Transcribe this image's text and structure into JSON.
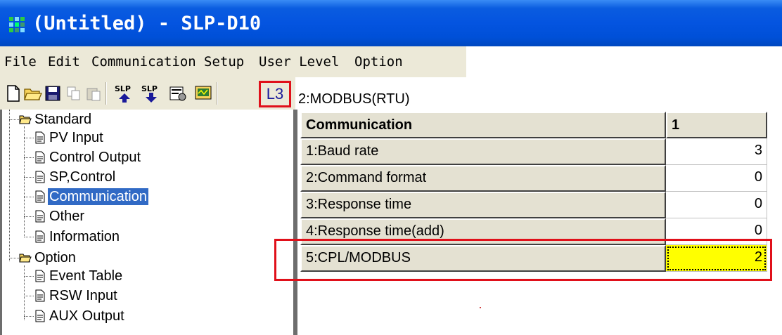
{
  "window": {
    "title": "(Untitled) - SLP-D10"
  },
  "menu": [
    {
      "label": "File"
    },
    {
      "label": "Edit"
    },
    {
      "label": "Communication"
    },
    {
      "label": "Setup"
    },
    {
      "label": "User Level"
    },
    {
      "label": "Option"
    }
  ],
  "toolbar": {
    "buttons": [
      {
        "icon": "new-file-icon"
      },
      {
        "icon": "open-folder-icon"
      },
      {
        "icon": "save-disk-icon"
      },
      {
        "icon": "copy-icon"
      },
      {
        "icon": "paste-icon"
      },
      {
        "icon": "slp-upload-icon"
      },
      {
        "icon": "slp-download-icon"
      },
      {
        "icon": "properties-icon"
      },
      {
        "icon": "monitor-icon"
      }
    ],
    "level_label": "L3"
  },
  "mode": {
    "text": "2:MODBUS(RTU)"
  },
  "tree": {
    "standard_label": "Standard",
    "standard_items": [
      {
        "label": "PV Input"
      },
      {
        "label": "Control Output"
      },
      {
        "label": "SP,Control"
      },
      {
        "label": "Communication",
        "selected": true
      },
      {
        "label": "Other"
      },
      {
        "label": "Information"
      }
    ],
    "option_label": "Option",
    "option_items": [
      {
        "label": "Event Table"
      },
      {
        "label": "RSW Input"
      },
      {
        "label": "AUX Output"
      }
    ]
  },
  "grid": {
    "header_label": "Communication",
    "header_col": "1",
    "rows": [
      {
        "label": "1:Baud rate",
        "value": "3"
      },
      {
        "label": "2:Command format",
        "value": "0"
      },
      {
        "label": "3:Response time",
        "value": "0"
      },
      {
        "label": "4:Response time(add)",
        "value": "0"
      },
      {
        "label": "5:CPL/MODBUS",
        "value": "2",
        "active": true
      }
    ]
  },
  "colors": {
    "titlebar": "#0454e0",
    "selection": "#316ac5",
    "highlight_cell": "#ffff00",
    "annotation": "#e0101a"
  }
}
